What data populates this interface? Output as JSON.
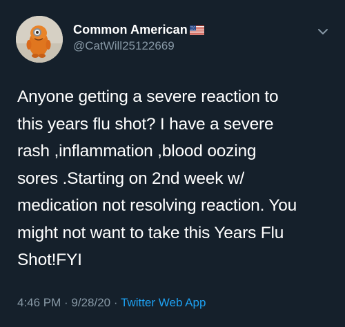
{
  "author": {
    "display_name": "Common American",
    "flag_emoji_icon": "us-flag-icon",
    "handle": "@CatWill25122669",
    "avatar_icon": "orange-plush-avatar"
  },
  "menu": {
    "icon": "chevron-down-icon"
  },
  "tweet": {
    "text": "Anyone getting  a severe reaction to\nthis years flu shot? I have a severe\nrash ,inflammation ,blood oozing\nsores .Starting on 2nd week w/\nmedication not resolving reaction. You\nmight not want to take this Years Flu\nShot!FYI"
  },
  "meta": {
    "time": "4:46 PM",
    "separator": " · ",
    "date": "9/28/20",
    "source": "Twitter Web App"
  },
  "colors": {
    "background": "#15202b",
    "secondary_text": "#8899a6",
    "link": "#1da1f2"
  }
}
